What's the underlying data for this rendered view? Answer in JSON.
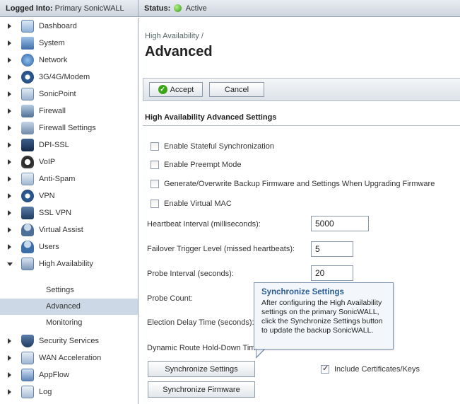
{
  "topbar": {
    "logged_prefix": "Logged Into:",
    "logged_value": "Primary SonicWALL",
    "status_prefix": "Status:",
    "status_value": "Active",
    "status_color": "#2e9a14"
  },
  "sidebar": {
    "items": [
      {
        "label": "Dashboard",
        "icon": "dashboard-icon"
      },
      {
        "label": "System",
        "icon": "system-icon"
      },
      {
        "label": "Network",
        "icon": "network-icon"
      },
      {
        "label": "3G/4G/Modem",
        "icon": "modem-icon"
      },
      {
        "label": "SonicPoint",
        "icon": "sonicpoint-icon"
      },
      {
        "label": "Firewall",
        "icon": "firewall-icon"
      },
      {
        "label": "Firewall Settings",
        "icon": "firewall-settings-icon"
      },
      {
        "label": "DPI-SSL",
        "icon": "dpi-ssl-icon"
      },
      {
        "label": "VoIP",
        "icon": "voip-icon"
      },
      {
        "label": "Anti-Spam",
        "icon": "anti-spam-icon"
      },
      {
        "label": "VPN",
        "icon": "vpn-icon"
      },
      {
        "label": "SSL VPN",
        "icon": "ssl-vpn-icon"
      },
      {
        "label": "Virtual Assist",
        "icon": "virtual-assist-icon"
      },
      {
        "label": "Users",
        "icon": "users-icon"
      },
      {
        "label": "High Availability",
        "icon": "high-availability-icon"
      },
      {
        "label": "Security Services",
        "icon": "security-services-icon"
      },
      {
        "label": "WAN Acceleration",
        "icon": "wan-acceleration-icon"
      },
      {
        "label": "AppFlow",
        "icon": "appflow-icon"
      },
      {
        "label": "Log",
        "icon": "log-icon"
      }
    ],
    "sub_items": [
      {
        "label": "Settings"
      },
      {
        "label": "Advanced",
        "active": true
      },
      {
        "label": "Monitoring"
      }
    ]
  },
  "main": {
    "breadcrumb": "High Availability /",
    "title": "Advanced",
    "accept_label": "Accept",
    "cancel_label": "Cancel",
    "section_title": "High Availability Advanced Settings",
    "checkboxes": [
      {
        "label": "Enable Stateful Synchronization",
        "checked": false
      },
      {
        "label": "Enable Preempt Mode",
        "checked": false
      },
      {
        "label": "Generate/Overwrite Backup Firmware and Settings When Upgrading Firmware",
        "checked": false
      },
      {
        "label": "Enable Virtual MAC",
        "checked": false
      }
    ],
    "fields": [
      {
        "label": "Heartbeat Interval (milliseconds):",
        "value": "5000"
      },
      {
        "label": "Failover Trigger Level (missed heartbeats):",
        "value": "5"
      },
      {
        "label": "Probe Interval (seconds):",
        "value": "20"
      },
      {
        "label": "Probe Count:",
        "value": ""
      },
      {
        "label": "Election Delay Time (seconds):",
        "value": ""
      },
      {
        "label": "Dynamic Route Hold-Down Time",
        "value": ""
      }
    ],
    "sync_settings_label": "Synchronize Settings",
    "sync_firmware_label": "Synchronize Firmware",
    "include_certs_label": "Include Certificates/Keys",
    "include_certs_checked": true
  },
  "tooltip": {
    "title": "Synchronize Settings",
    "body": "After configuring the High Availability settings on the primary SonicWALL, click the Synchronize Settings button to update the backup SonicWALL."
  }
}
